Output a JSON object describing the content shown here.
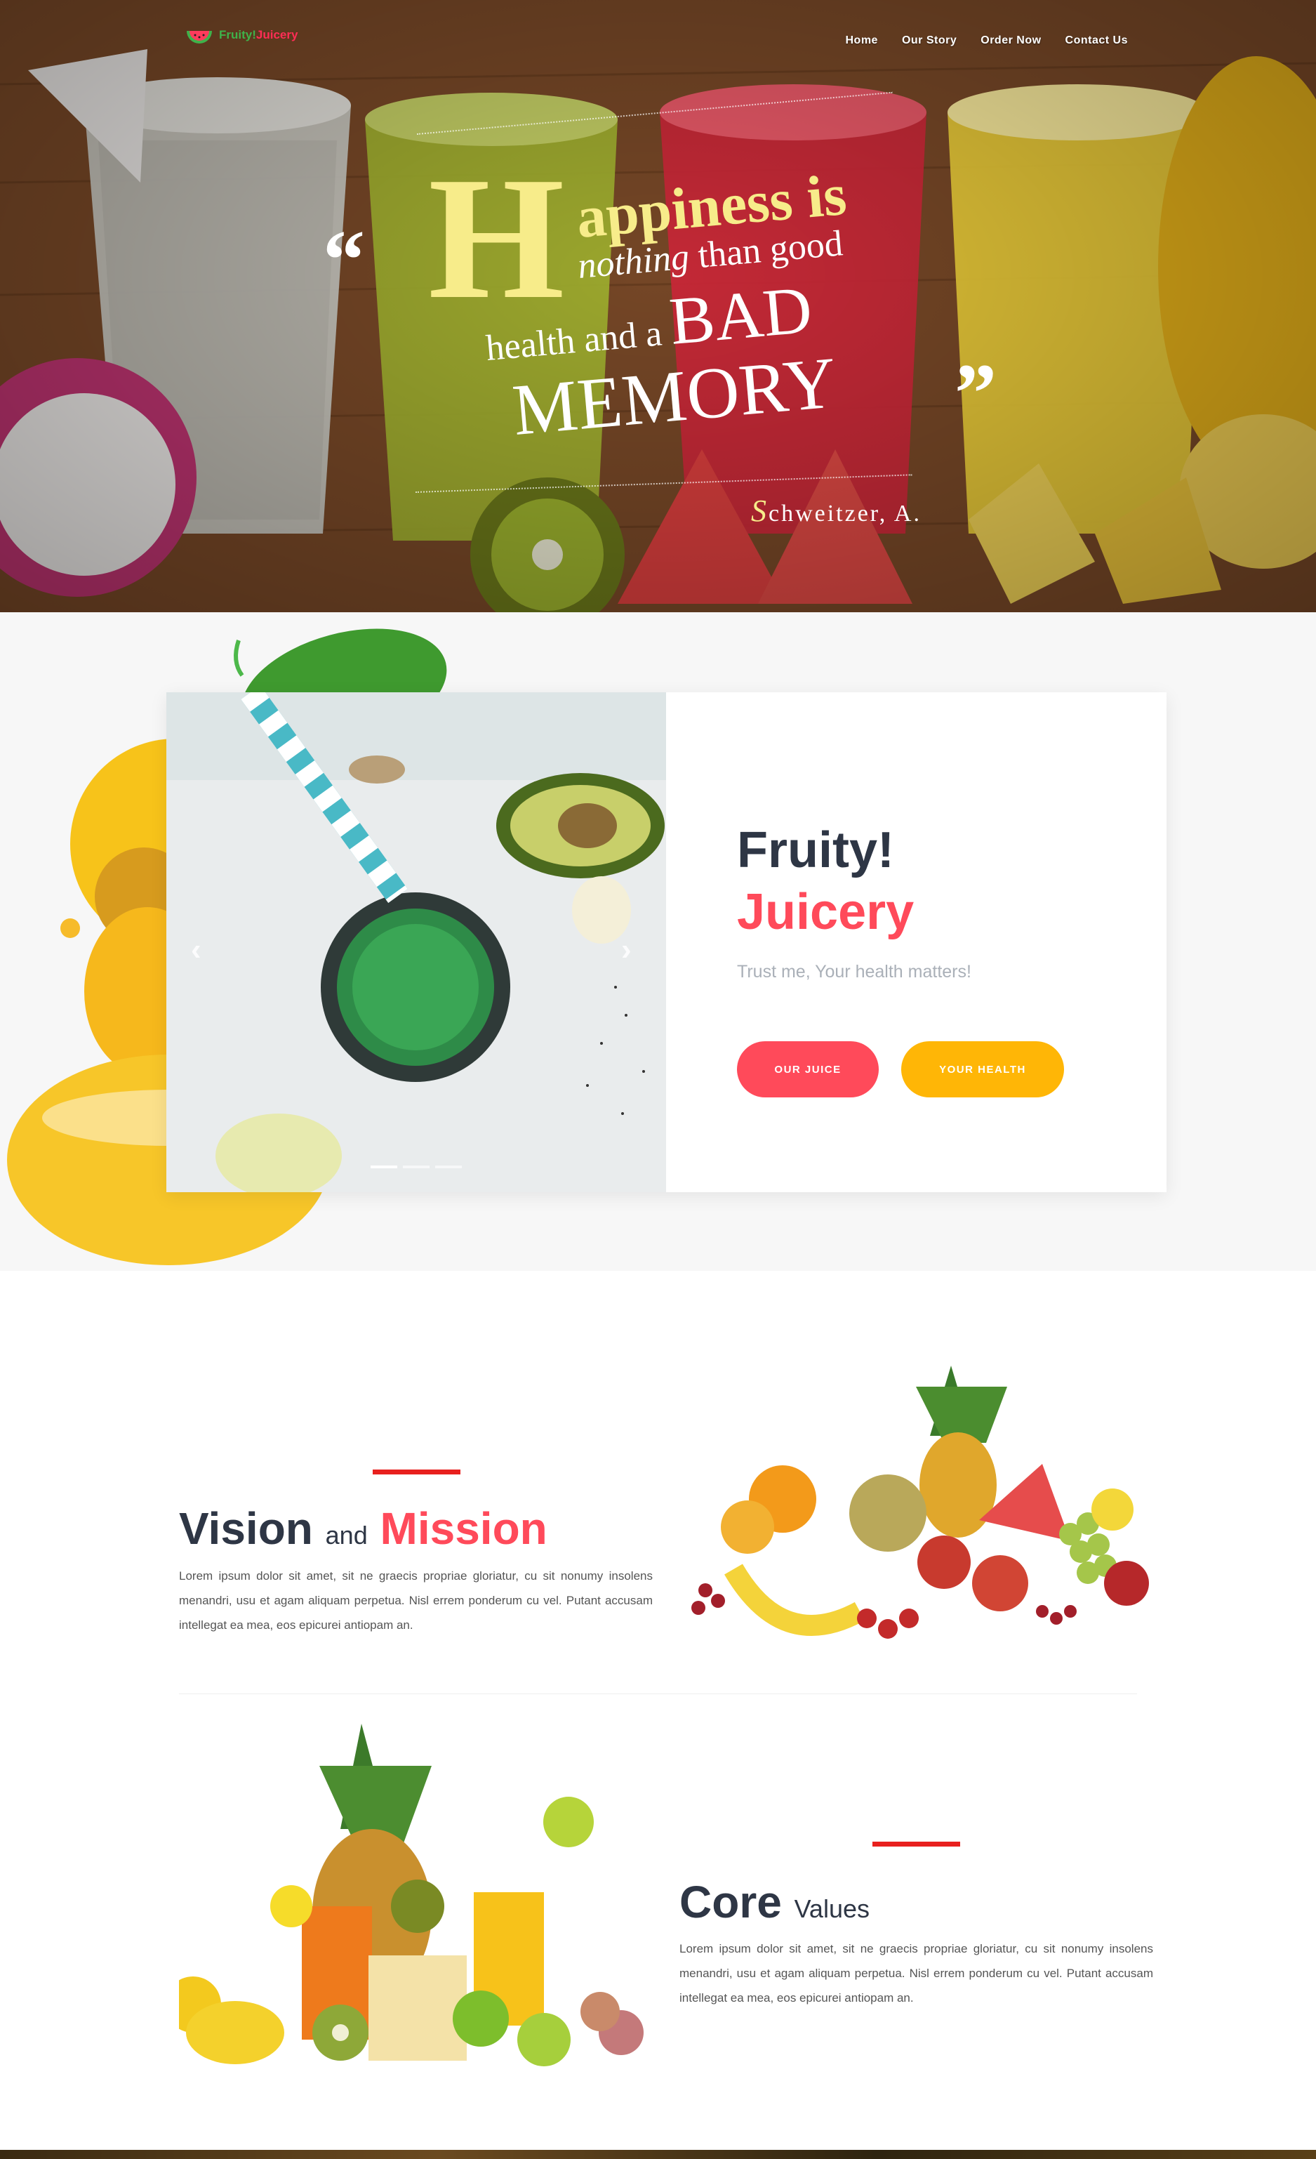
{
  "brand": {
    "logo_word1": "Fruity!",
    "logo_word2": "Juicery"
  },
  "nav": {
    "items": [
      {
        "label": "Home"
      },
      {
        "label": "Our Story"
      },
      {
        "label": "Order Now"
      },
      {
        "label": "Contact Us"
      }
    ]
  },
  "hero": {
    "open_quote": "“",
    "close_quote": "”",
    "initial": "H",
    "line1": "appiness is",
    "line2_italic": "nothing",
    "line2_rest": " than good",
    "line3_small": "health and a ",
    "line3_big": "BAD",
    "line4": "MEMORY",
    "author_initial": "S",
    "author_rest": "chweitzer, A."
  },
  "slider": {
    "prev": "‹",
    "next": "›",
    "dots": 3,
    "active_dot": 0
  },
  "feature": {
    "title": "Fruity!",
    "subtitle": "Juicery",
    "tagline": "Trust me, Your health matters!",
    "btn_juice": "OUR JUICE",
    "btn_health": "YOUR HEALTH"
  },
  "vision": {
    "title_a": "Vision",
    "title_and": "and",
    "title_b": "Mission",
    "body": "Lorem ipsum dolor sit amet, sit ne graecis propriae gloriatur, cu sit nonumy insolens menandri, usu et agam aliquam perpetua. Nisl errem ponderum cu vel. Putant accusam intellegat ea mea, eos epicurei antiopam an."
  },
  "core": {
    "title_a": "Core",
    "title_b": "Values",
    "body": "Lorem ipsum dolor sit amet, sit ne graecis propriae gloriatur, cu sit nonumy insolens menandri, usu et agam aliquam perpetua. Nisl errem ponderum cu vel. Putant accusam intellegat ea mea, eos epicurei antiopam an."
  },
  "colors": {
    "dark_text": "#2e3645",
    "accent_red": "#ff4a5a",
    "accent_yellow": "#ffb606",
    "quote_yellow": "#f7ec8a",
    "rule_red": "#e8201e"
  }
}
